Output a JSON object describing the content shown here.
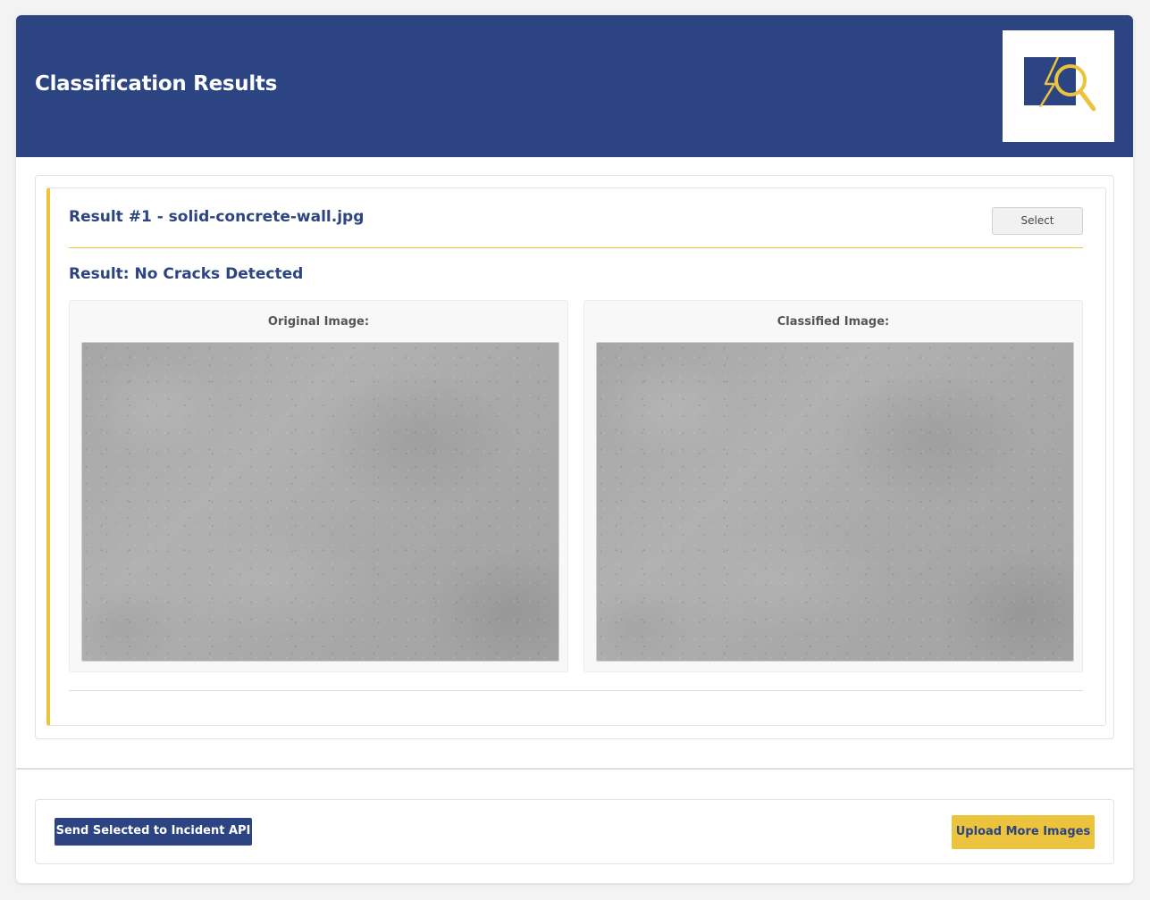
{
  "header": {
    "title": "Classification Results",
    "logo_icon": "crack-inspection-logo-icon"
  },
  "results": [
    {
      "title": "Result #1 - solid-concrete-wall.jpg",
      "select_label": "Select",
      "status": "Result: No Cracks Detected",
      "original_label": "Original Image:",
      "classified_label": "Classified Image:"
    }
  ],
  "footer": {
    "send_label": "Send Selected to Incident API",
    "upload_label": "Upload More Images"
  },
  "colors": {
    "brand_navy": "#2c4482",
    "accent_gold": "#ecc33d"
  }
}
